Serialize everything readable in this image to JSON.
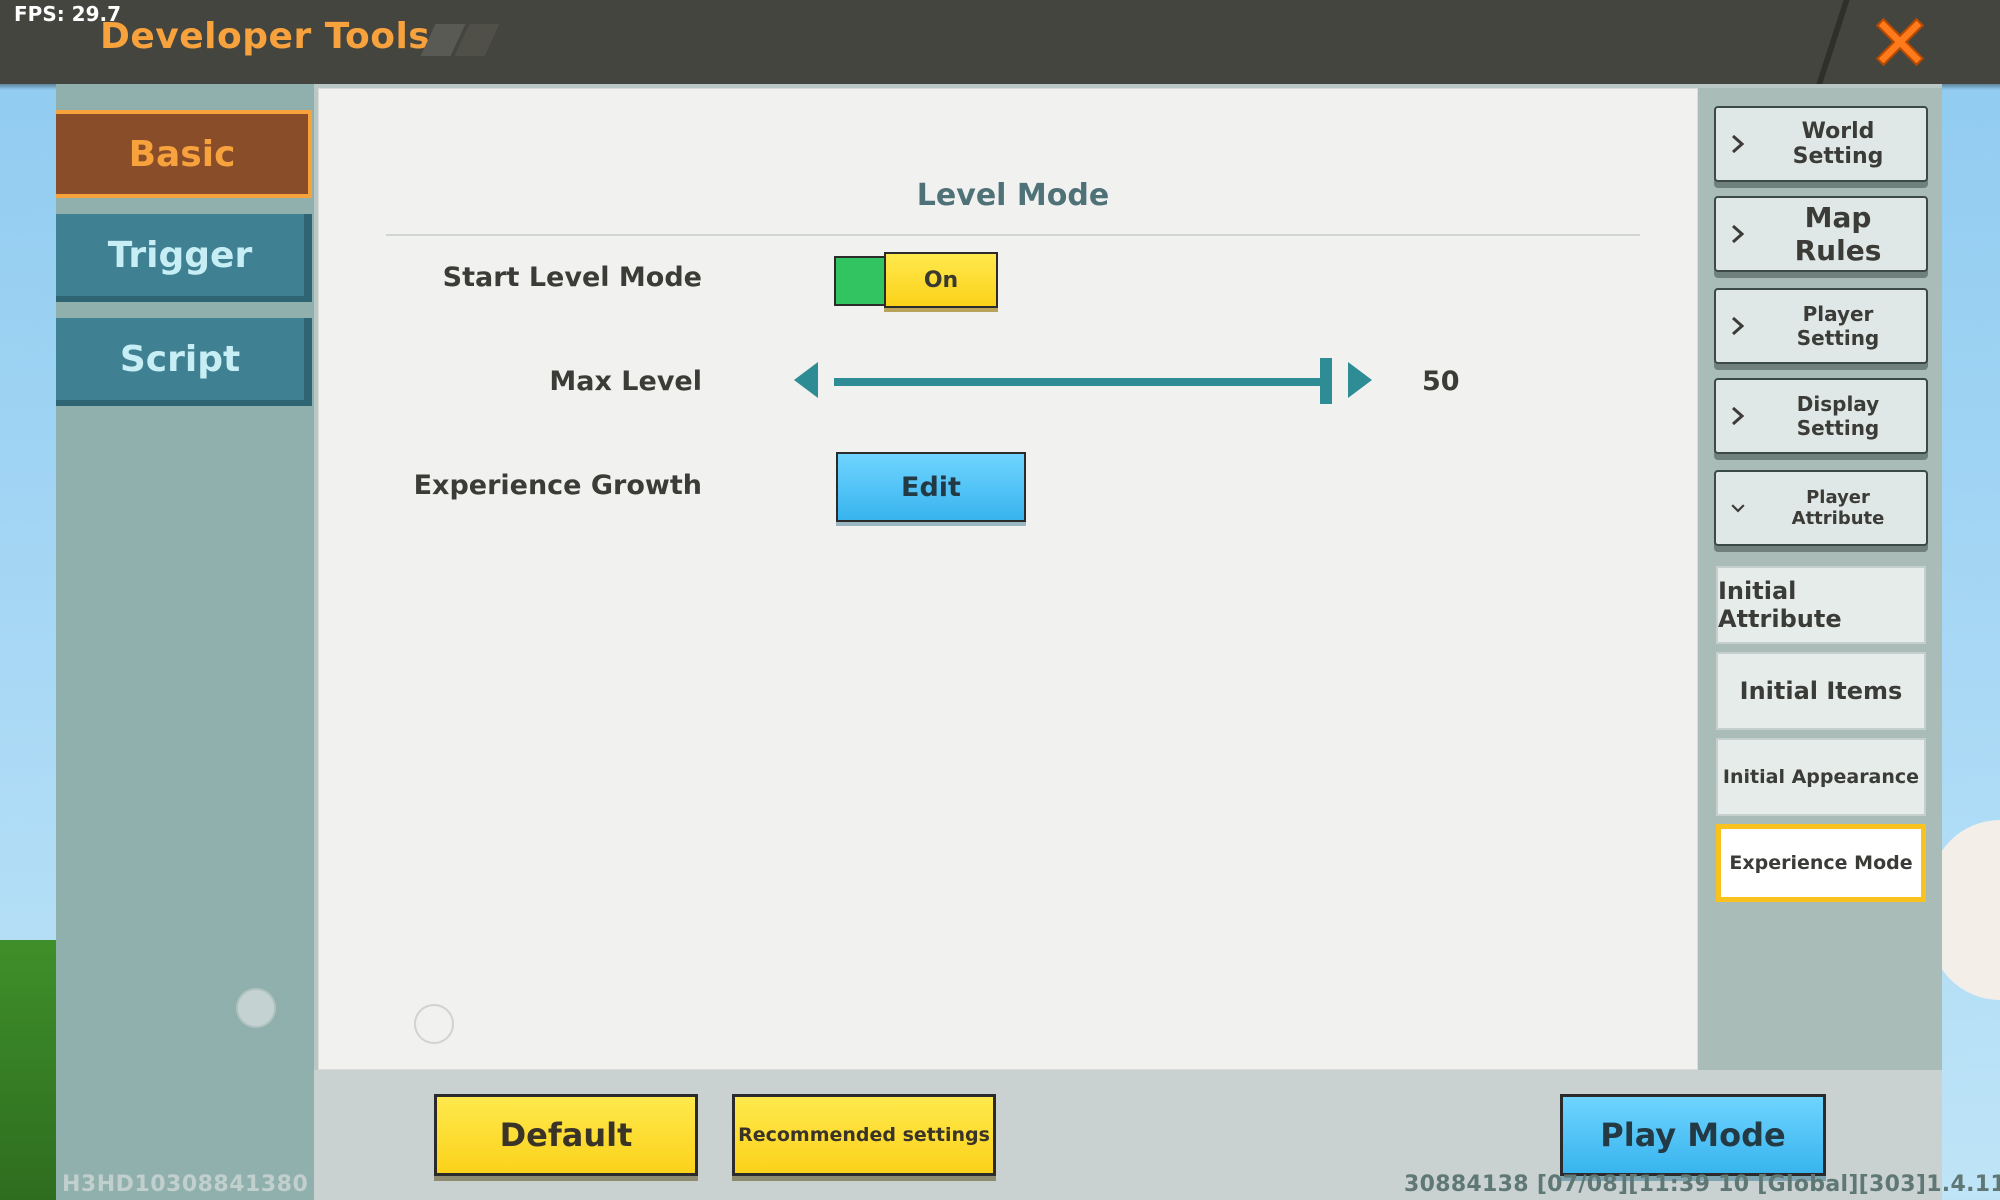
{
  "hud": {
    "fps": "FPS: 29.7"
  },
  "header": {
    "title": "Developer Tools"
  },
  "left_nav": {
    "items": [
      {
        "label": "Basic",
        "active": true
      },
      {
        "label": "Trigger",
        "active": false
      },
      {
        "label": "Script",
        "active": false
      }
    ]
  },
  "main": {
    "section_title": "Level Mode",
    "start_level_mode": {
      "label": "Start Level Mode",
      "toggle_text": "On",
      "toggle_on": true
    },
    "max_level": {
      "label": "Max Level",
      "value": "50",
      "fraction": 1.0
    },
    "experience_growth": {
      "label": "Experience Growth",
      "button_label": "Edit"
    }
  },
  "right_nav": {
    "items": [
      {
        "label": "World Setting",
        "expanded": false
      },
      {
        "label": "Map Rules",
        "expanded": false
      },
      {
        "label": "Player Setting",
        "expanded": false
      },
      {
        "label": "Display Setting",
        "expanded": false
      },
      {
        "label": "Player Attribute",
        "expanded": true
      }
    ],
    "sub_items": [
      {
        "label": "Initial Attribute",
        "active": false
      },
      {
        "label": "Initial Items",
        "active": false
      },
      {
        "label": "Initial Appearance",
        "active": false
      },
      {
        "label": "Experience Mode",
        "active": true
      }
    ]
  },
  "footer": {
    "default_label": "Default",
    "recommended_label": "Recommended settings",
    "play_mode_label": "Play Mode",
    "map_id": "H3HD10308841380",
    "version_info": "30884138   [07/08][11:39 10   [Global][303]1.4.11"
  },
  "colors": {
    "accent_orange": "#f7a23c",
    "active_nav_bg": "#8a4d29",
    "teal": "#2e8c94",
    "yellow_button": "#fbd21a",
    "blue_button": "#38b4ee",
    "toggle_green": "#33c462",
    "active_sub_border": "#f9c21f"
  }
}
